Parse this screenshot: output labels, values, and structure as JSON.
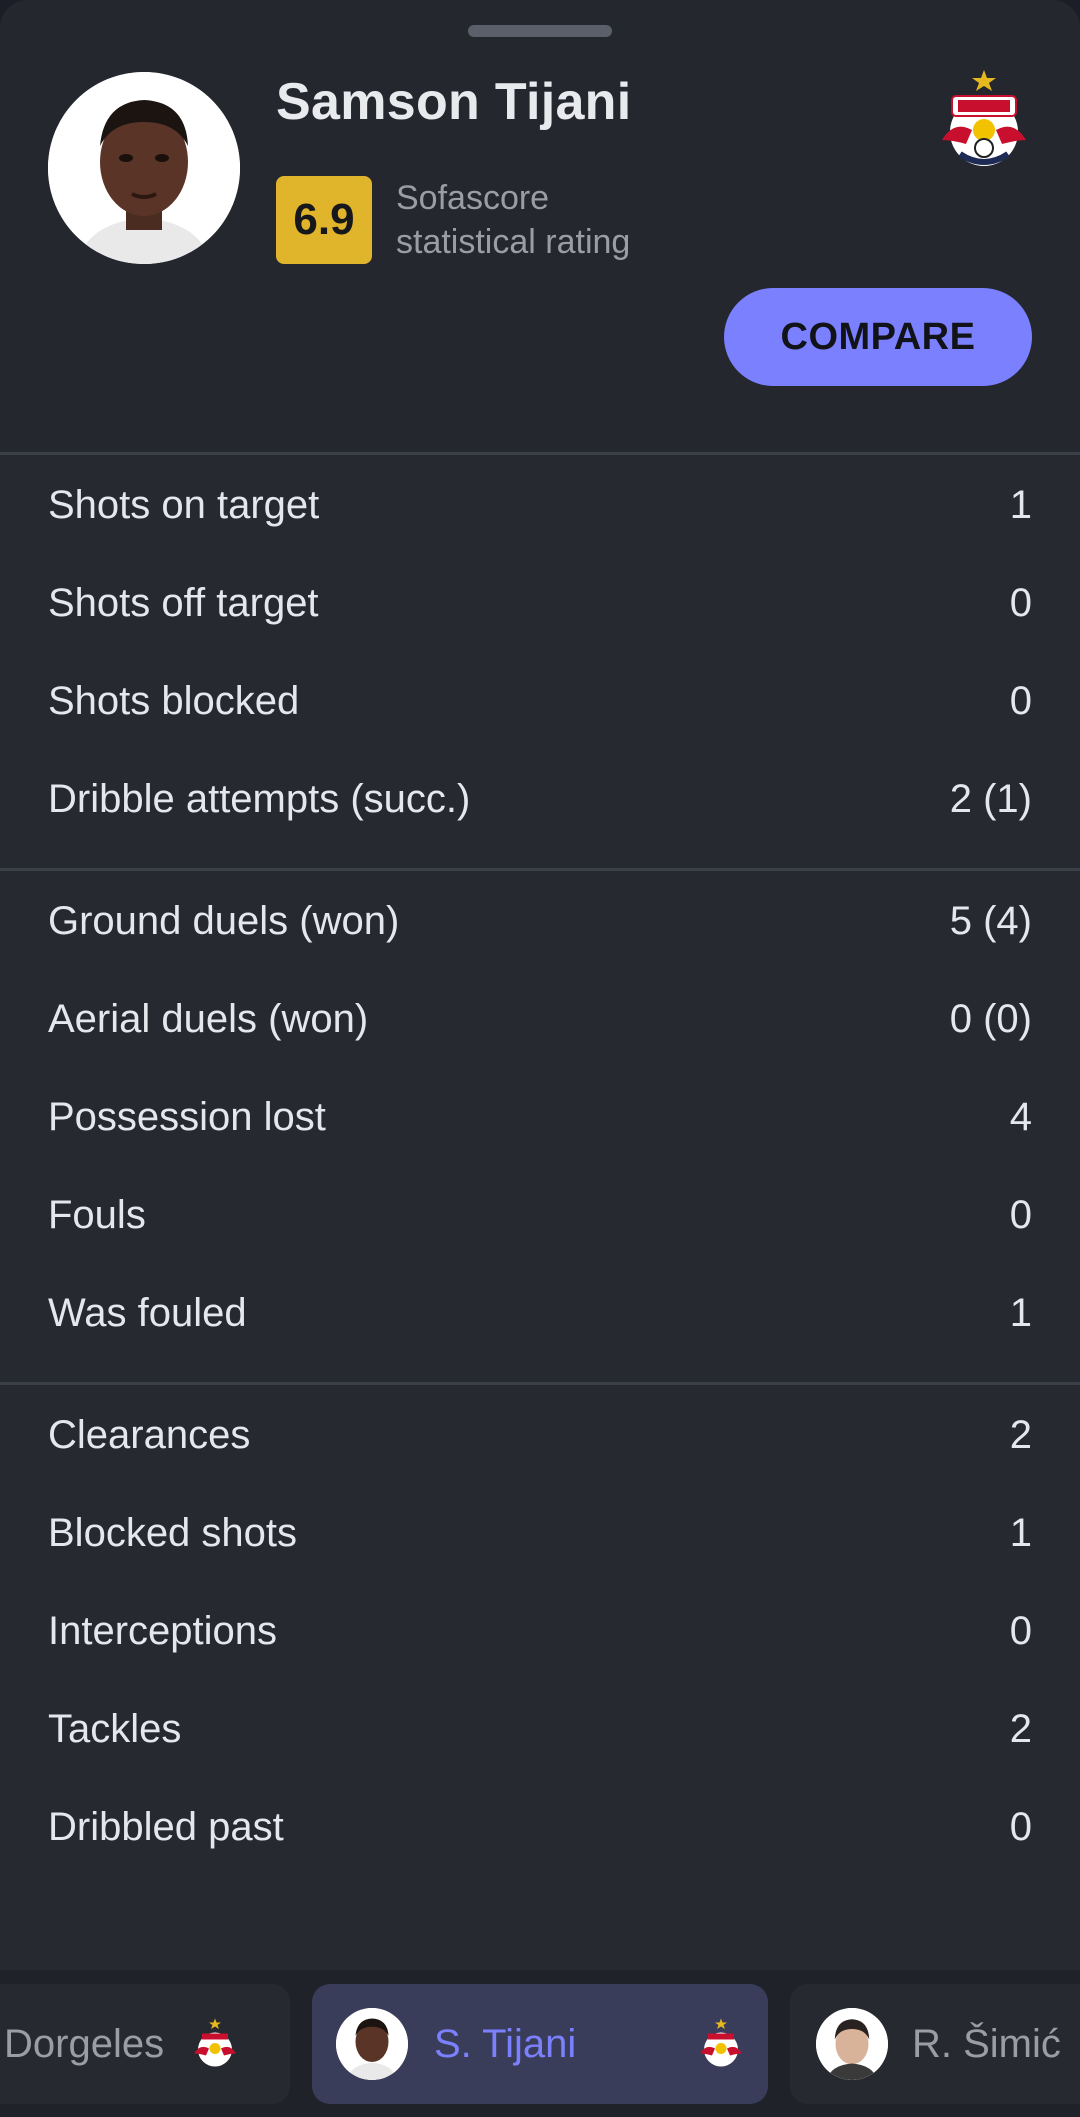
{
  "player": {
    "name": "Samson Tijani",
    "rating": "6.9",
    "rating_caption_line1": "Sofascore",
    "rating_caption_line2": "statistical rating",
    "club_logo_icon": "red-bull-salzburg-logo"
  },
  "compare_button": {
    "label": "COMPARE"
  },
  "stat_groups": [
    {
      "rows": [
        {
          "label": "Shots on target",
          "value": "1"
        },
        {
          "label": "Shots off target",
          "value": "0"
        },
        {
          "label": "Shots blocked",
          "value": "0"
        },
        {
          "label": "Dribble attempts (succ.)",
          "value": "2 (1)"
        }
      ]
    },
    {
      "rows": [
        {
          "label": "Ground duels (won)",
          "value": "5 (4)"
        },
        {
          "label": "Aerial duels (won)",
          "value": "0 (0)"
        },
        {
          "label": "Possession lost",
          "value": "4"
        },
        {
          "label": "Fouls",
          "value": "0"
        },
        {
          "label": "Was fouled",
          "value": "1"
        }
      ]
    },
    {
      "rows": [
        {
          "label": "Clearances",
          "value": "2"
        },
        {
          "label": "Blocked shots",
          "value": "1"
        },
        {
          "label": "Interceptions",
          "value": "0"
        },
        {
          "label": "Tackles",
          "value": "2"
        },
        {
          "label": "Dribbled past",
          "value": "0"
        }
      ]
    }
  ],
  "player_switcher": {
    "prev": {
      "name": "Dorgeles"
    },
    "current": {
      "name": "S. Tijani"
    },
    "next": {
      "name": "R. Šimić"
    }
  },
  "colors": {
    "accent": "#7b80ff",
    "rating_badge": "#e0b52b",
    "background": "#262930"
  }
}
